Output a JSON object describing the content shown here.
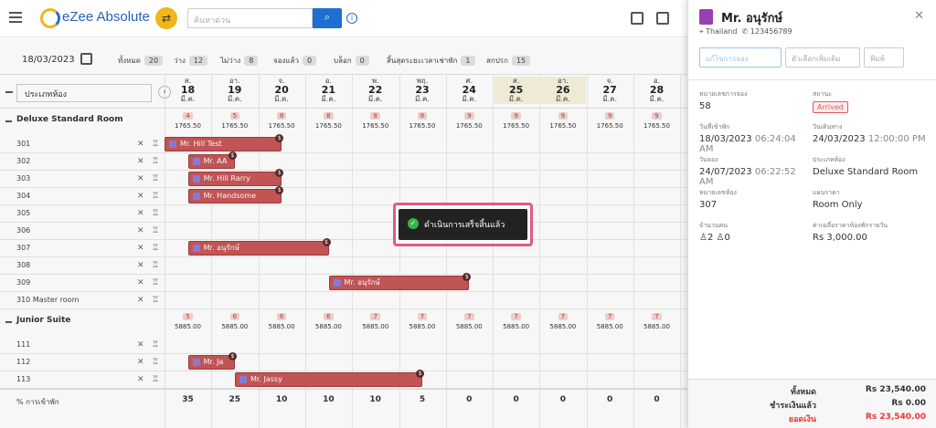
{
  "app": {
    "name": "eZee Absolute",
    "search_placeholder": "ค้นหาด่วน"
  },
  "toolbar": {
    "date": "18/03/2023",
    "stats": [
      {
        "label": "ทั้งหมด",
        "value": "20"
      },
      {
        "label": "ว่าง",
        "value": "12"
      },
      {
        "label": "ไม่ว่าง",
        "value": "8"
      },
      {
        "label": "จองแล้ว",
        "value": "0"
      },
      {
        "label": "บล็อก",
        "value": "0"
      },
      {
        "label": "สิ้นสุดระยะเวลาเช่าพัก",
        "value": "1"
      },
      {
        "label": "สกปรก",
        "value": "15"
      }
    ]
  },
  "grid": {
    "room_type_select": "ประเภทห้อง",
    "days": [
      {
        "dow": "ส.",
        "date": "18",
        "mon": "มี.ค."
      },
      {
        "dow": "อา.",
        "date": "19",
        "mon": "มี.ค."
      },
      {
        "dow": "จ.",
        "date": "20",
        "mon": "มี.ค."
      },
      {
        "dow": "อ.",
        "date": "21",
        "mon": "มี.ค."
      },
      {
        "dow": "พ.",
        "date": "22",
        "mon": "มี.ค."
      },
      {
        "dow": "พฤ.",
        "date": "23",
        "mon": "มี.ค."
      },
      {
        "dow": "ศ.",
        "date": "24",
        "mon": "มี.ค."
      },
      {
        "dow": "ส.",
        "date": "25",
        "mon": "มี.ค."
      },
      {
        "dow": "อา.",
        "date": "26",
        "mon": "มี.ค."
      },
      {
        "dow": "จ.",
        "date": "27",
        "mon": "มี.ค."
      },
      {
        "dow": "อ.",
        "date": "28",
        "mon": "มี.ค."
      }
    ],
    "categories": [
      {
        "name": "Deluxe Standard Room",
        "avail": [
          "4",
          "5",
          "8",
          "8",
          "8",
          "8",
          "9",
          "9",
          "9",
          "9",
          "9"
        ],
        "rate": "1765.50",
        "rooms": [
          "301",
          "302",
          "303",
          "304",
          "305",
          "306",
          "307",
          "308",
          "309",
          "310 Master room"
        ]
      },
      {
        "name": "Junior Suite",
        "avail": [
          "5",
          "6",
          "6",
          "6",
          "7",
          "7",
          "7",
          "7",
          "7",
          "7",
          "7"
        ],
        "rate": "5885.00",
        "rooms": [
          "111",
          "112",
          "113"
        ]
      }
    ],
    "bookings": [
      "Mr. Hill Test",
      "Mr. AA",
      "Mr. Hill Rarry",
      "Mr. Handsome",
      "Mr. อนุรักษ์",
      "Mr. อนุรักษ์",
      "Mr. Ja",
      "Mr. Jassy"
    ],
    "occupancy_label": "% การเข้าพัก",
    "occupancy": [
      "35",
      "25",
      "10",
      "10",
      "10",
      "5",
      "0",
      "0",
      "0",
      "0",
      "0"
    ]
  },
  "toast": {
    "message": "ดำเนินการเสร็จสิ้นแล้ว"
  },
  "panel": {
    "guest_name": "Mr. อนุรักษ์",
    "country": "Thailand",
    "phone": "123456789",
    "btn_edit": "แก้ไขการจอง",
    "btn_more": "ตัวเลือกเพิ่มเติม",
    "btn_print": "พิมพ์",
    "fields": {
      "res_no_label": "หมายเลขการจอง",
      "res_no": "58",
      "status_label": "สถานะ",
      "status": "Arrived",
      "arrival_label": "วันที่เข้าพัก",
      "arrival_date": "18/03/2023",
      "arrival_time": "06:24:04 AM",
      "departure_label": "วันเดินทาง",
      "departure_date": "24/03/2023",
      "departure_time": "12:00:00 PM",
      "booking_label": "วันจอง",
      "booking_date": "24/07/2023",
      "booking_time": "06:22:52 AM",
      "room_type_label": "ประเภทห้อง",
      "room_type": "Deluxe Standard Room",
      "room_no_label": "หมายเลขห้อง",
      "room_no": "307",
      "plan_label": "แผนราคา",
      "plan": "Room Only",
      "pax_label": "จำนวนคน",
      "adults": "2",
      "children": "0",
      "avg_rate_label": "ค่าเฉลี่ยราคาห้องพักรายวัน",
      "avg_rate": "Rs 3,000.00"
    },
    "footer": {
      "total_label": "ทั้งหมด",
      "total": "Rs 23,540.00",
      "paid_label": "ชำระเงินแล้ว",
      "paid": "Rs 0.00",
      "balance_label": "ยอดเงิน",
      "balance": "Rs 23,540.00"
    }
  }
}
